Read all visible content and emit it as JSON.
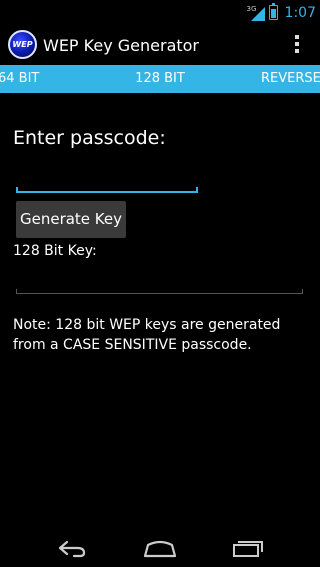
{
  "status_bar": {
    "network": "3G",
    "time": "1:07"
  },
  "action_bar": {
    "app_icon_text": "WEP",
    "title": "WEP Key Generator"
  },
  "tabs": [
    {
      "label": "64 BIT"
    },
    {
      "label": "128 BIT"
    },
    {
      "label": "REVERSE"
    }
  ],
  "content": {
    "passcode_label": "Enter passcode:",
    "passcode_value": "",
    "generate_button": "Generate Key",
    "key_label": "128 Bit Key:",
    "key_value": "",
    "note": "Note: 128 bit WEP keys are generated from a CASE SENSITIVE passcode."
  },
  "colors": {
    "accent": "#33b5e5",
    "background": "#000000",
    "button": "#3a3a3a"
  },
  "nav_bar": {
    "icons": [
      "back-icon",
      "home-icon",
      "recent-apps-icon"
    ]
  }
}
